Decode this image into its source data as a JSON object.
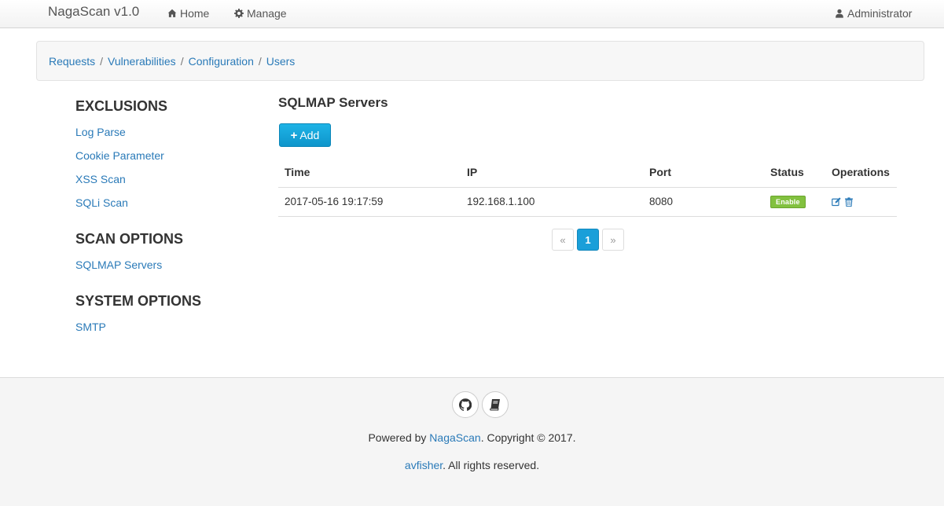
{
  "navbar": {
    "brand": "NagaScan v1.0",
    "home": "Home",
    "manage": "Manage",
    "user": "Administrator"
  },
  "breadcrumb": [
    "Requests",
    "Vulnerabilities",
    "Configuration",
    "Users"
  ],
  "sidebar": {
    "exclusions_title": "EXCLUSIONS",
    "exclusions": [
      "Log Parse",
      "Cookie Parameter",
      "XSS Scan",
      "SQLi Scan"
    ],
    "scan_title": "SCAN OPTIONS",
    "scan": [
      "SQLMAP Servers"
    ],
    "system_title": "SYSTEM OPTIONS",
    "system": [
      "SMTP"
    ]
  },
  "main": {
    "title": "SQLMAP Servers",
    "add_label": "Add",
    "columns": [
      "Time",
      "IP",
      "Port",
      "Status",
      "Operations"
    ],
    "rows": [
      {
        "time": "2017-05-16 19:17:59",
        "ip": "192.168.1.100",
        "port": "8080",
        "status": "Enable"
      }
    ]
  },
  "pagination": {
    "prev": "«",
    "current": "1",
    "next": "»"
  },
  "footer": {
    "powered_prefix": "Powered by ",
    "powered_link": "NagaScan",
    "powered_suffix": ". Copyright © 2017.",
    "author_link": "avfisher",
    "author_suffix": ". All rights reserved."
  },
  "colors": {
    "accent": "#1a9fd9",
    "link": "#2a7ab8",
    "status_green": "#82c13f"
  }
}
